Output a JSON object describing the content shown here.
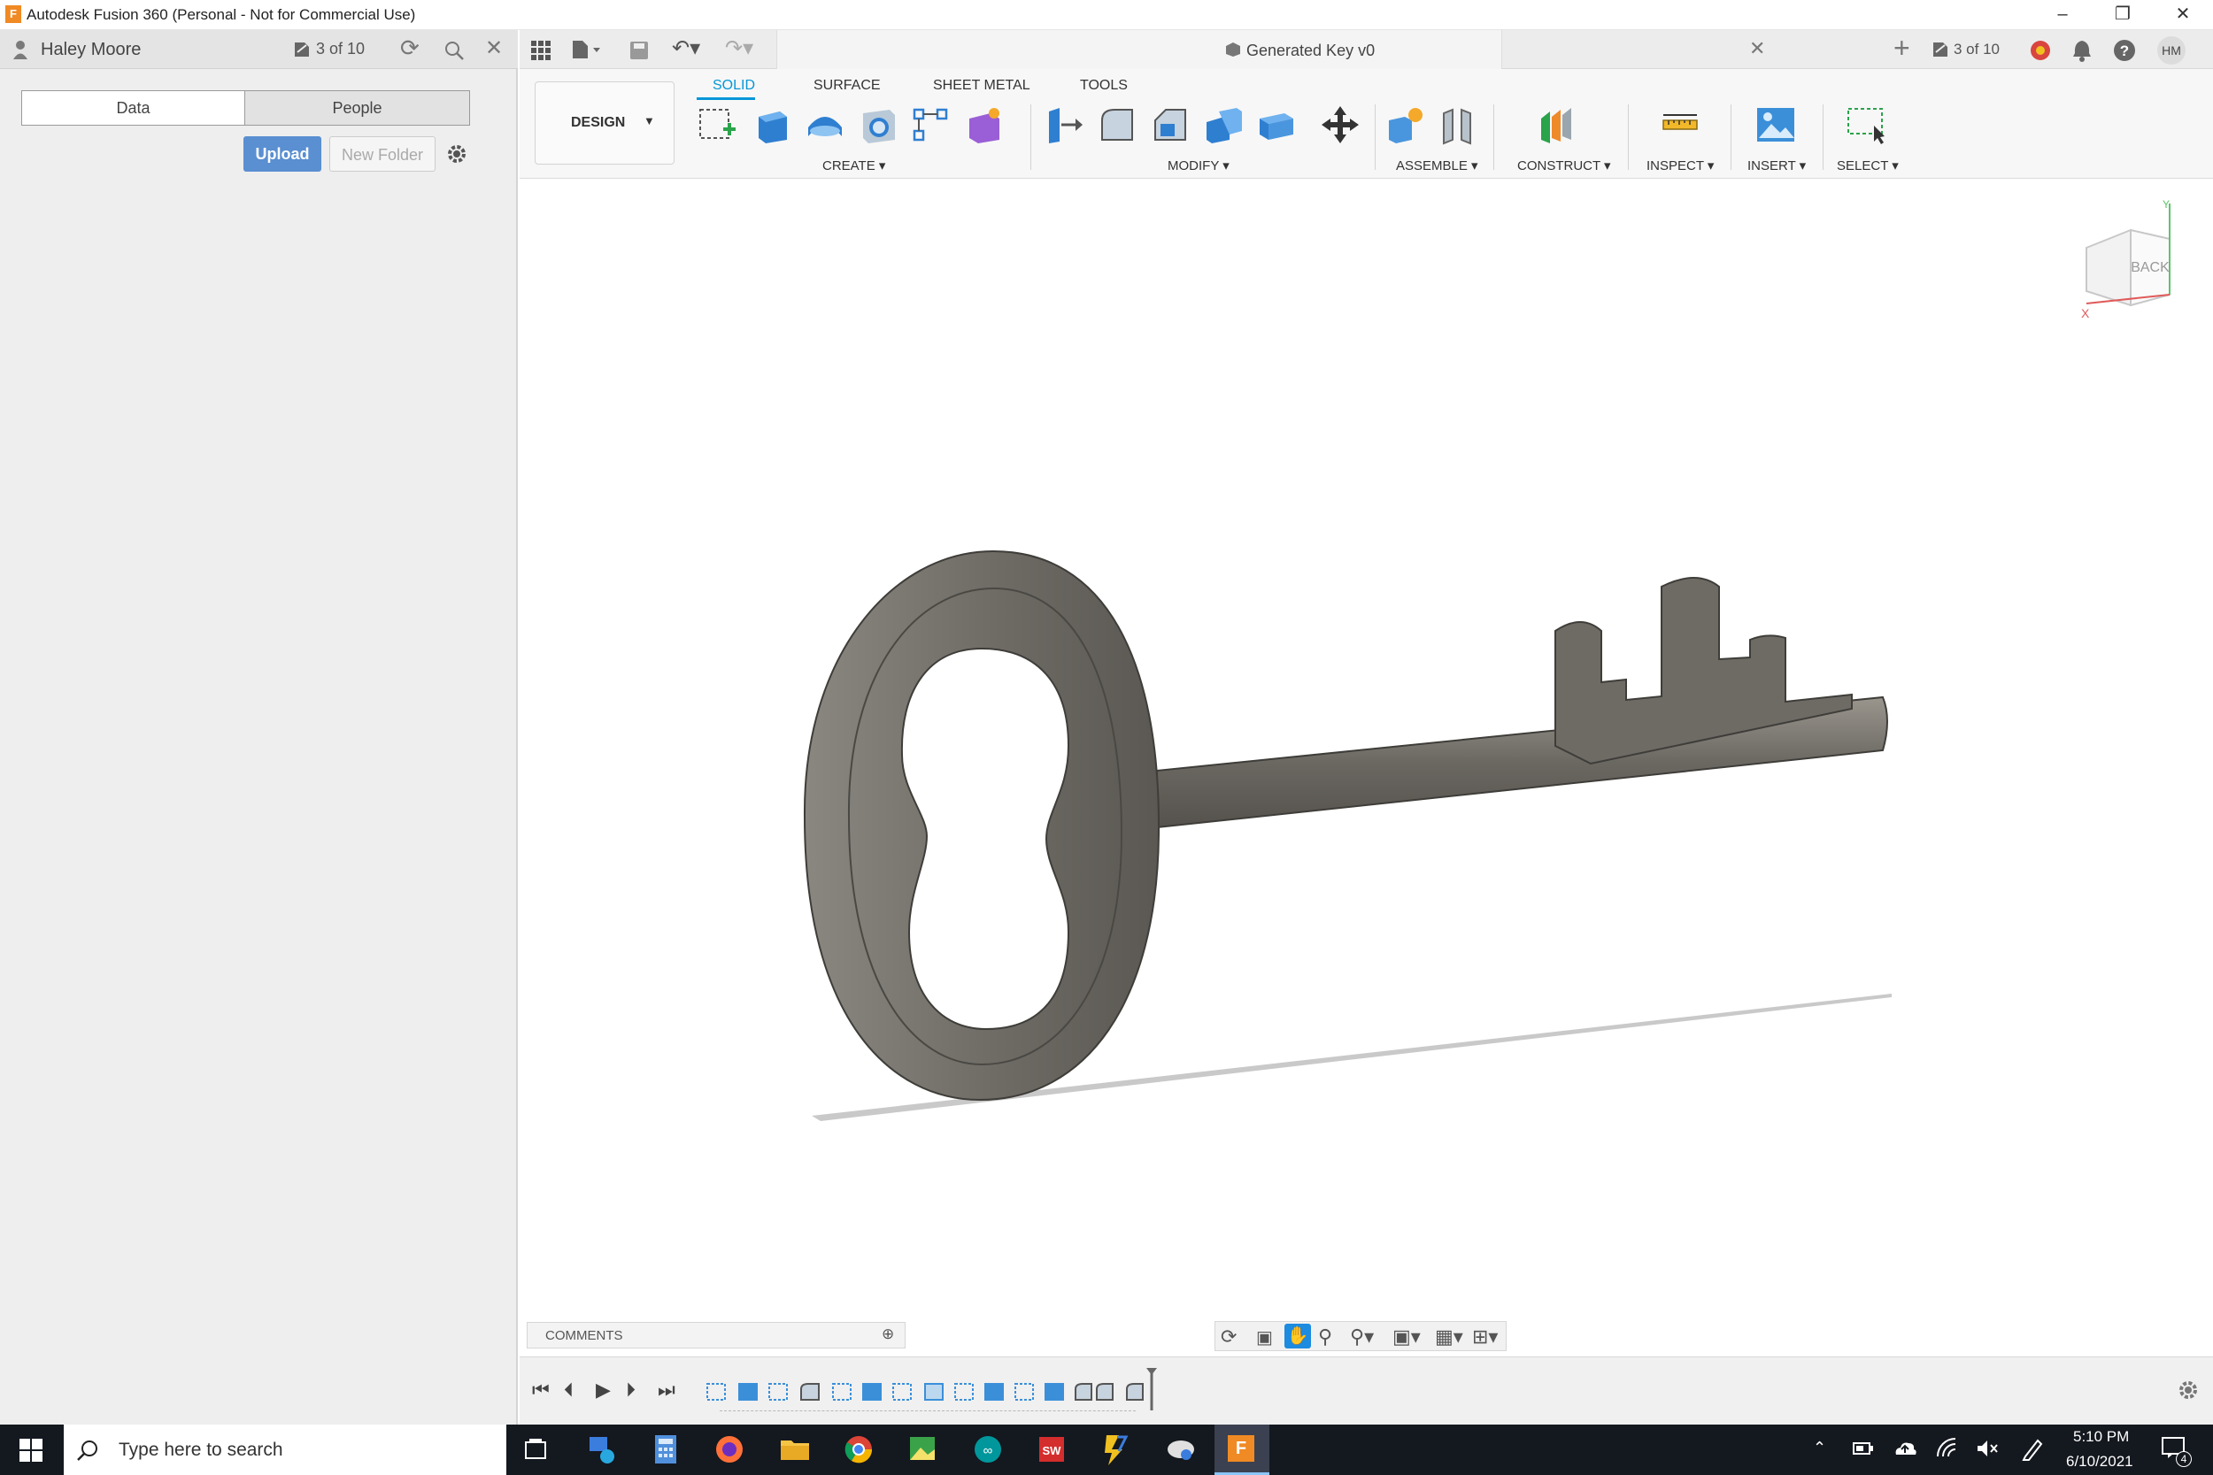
{
  "window": {
    "title": "Autodesk Fusion 360 (Personal - Not for Commercial Use)",
    "logo_letter": "F"
  },
  "data_panel": {
    "user_name": "Haley Moore",
    "version_counter": "3 of 10",
    "tabs": [
      "Data",
      "People"
    ],
    "upload_label": "Upload",
    "new_folder_label": "New Folder"
  },
  "document": {
    "tab_title": "Generated Key v0",
    "version_counter": "3 of 10",
    "user_initials": "HM"
  },
  "toolbar": {
    "workspace": "DESIGN",
    "tabs": [
      "SOLID",
      "SURFACE",
      "SHEET METAL",
      "TOOLS"
    ],
    "active_tab": "SOLID",
    "groups": [
      "CREATE",
      "MODIFY",
      "ASSEMBLE",
      "CONSTRUCT",
      "INSPECT",
      "INSERT",
      "SELECT"
    ]
  },
  "viewcube": {
    "face": "BACK",
    "axis_x": "X",
    "axis_y": "Y"
  },
  "comments": {
    "label": "COMMENTS"
  },
  "taskbar": {
    "search_placeholder": "Type here to search",
    "time": "5:10 PM",
    "date": "6/10/2021",
    "notification_count": "4"
  },
  "colors": {
    "accent": "#0696d7",
    "upload_button": "#5a8fd1",
    "model_grey": "#6e6b65",
    "taskbar": "#14181f"
  }
}
